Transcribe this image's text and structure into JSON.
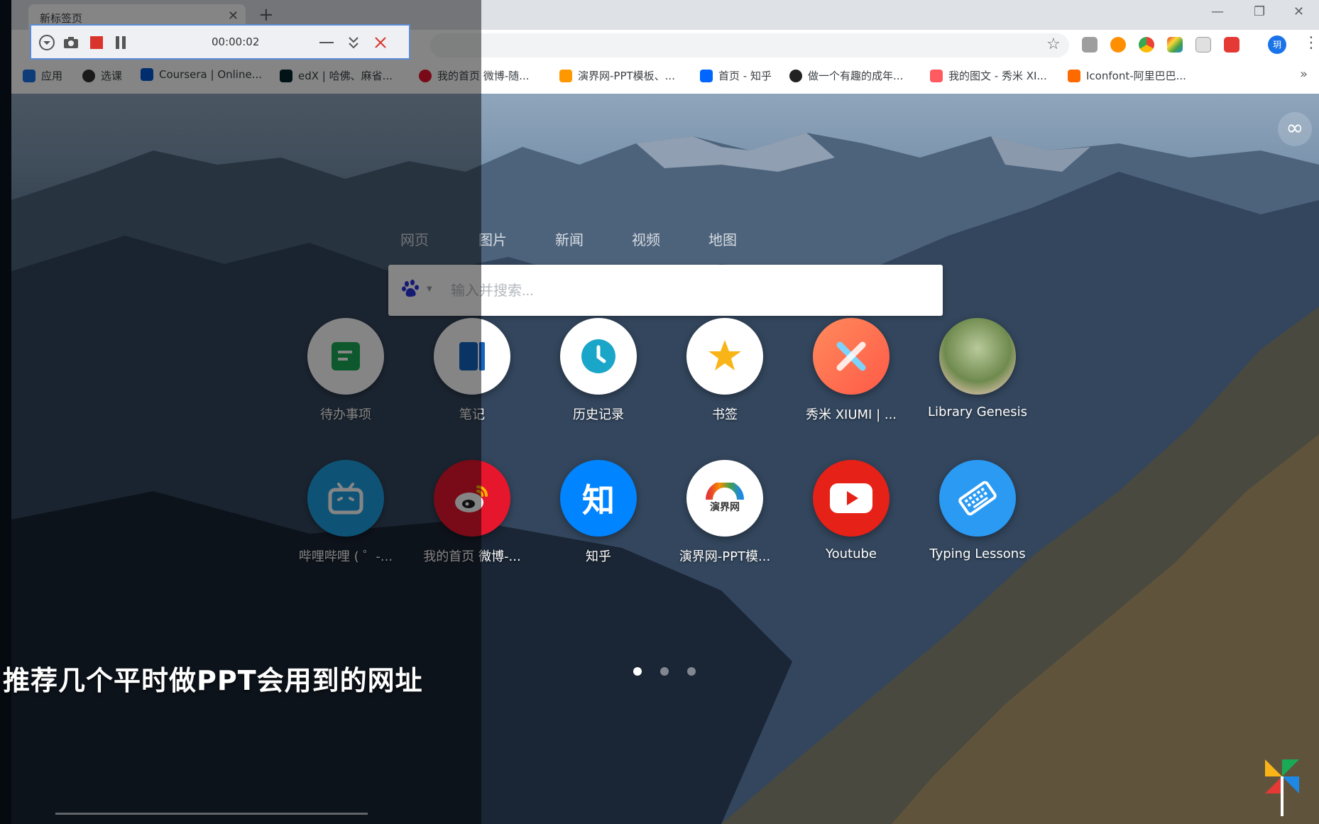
{
  "browser": {
    "tab_title": "新标签页",
    "tab_close": "✕",
    "new_tab": "+",
    "window_controls": {
      "minimize": "—",
      "restore": "❐",
      "close": "✕"
    },
    "toolbar": {
      "star": "☆",
      "profile_initial": "玥",
      "menu": "⋮"
    },
    "extension_icons": [
      "translate-icon",
      "infinity-ext-icon",
      "chrome-ext-icon",
      "color-ext-icon",
      "reader-ext-icon",
      "red-ext-icon"
    ]
  },
  "bookmarks": {
    "items": [
      {
        "label": "应用",
        "icon": "apps-grid-icon",
        "color": "#1a73e8"
      },
      {
        "label": "选课",
        "icon": "globe-icon",
        "color": "#333333"
      },
      {
        "label": "Coursera | Online...",
        "icon": "coursera-icon",
        "color": "#0056d2"
      },
      {
        "label": "edX | 哈佛、麻省...",
        "icon": "edx-icon",
        "color": "#02262b"
      },
      {
        "label": "我的首页 微博-随...",
        "icon": "weibo-icon",
        "color": "#e6162d"
      },
      {
        "label": "演界网-PPT模板、...",
        "icon": "yanjie-icon",
        "color": "#ff9800"
      },
      {
        "label": "首页 - 知乎",
        "icon": "zhihu-icon",
        "color": "#0066ff"
      },
      {
        "label": "做一个有趣的成年...",
        "icon": "dark-site-icon",
        "color": "#222222"
      },
      {
        "label": "我的图文 - 秀米 XI...",
        "icon": "xiumi-icon",
        "color": "#ff5a5f"
      },
      {
        "label": "Iconfont-阿里巴巴...",
        "icon": "iconfont-icon",
        "color": "#ff6a00"
      }
    ],
    "more": "»"
  },
  "newtab": {
    "corner_button": "∞",
    "search_tabs": [
      "网页",
      "图片",
      "新闻",
      "视频",
      "地图"
    ],
    "search_placeholder": "输入并搜索...",
    "engine_icon": "baidu-paw-icon",
    "tiles": [
      {
        "label": "待办事项",
        "icon": "todo-icon",
        "bg": "#ffffff"
      },
      {
        "label": "笔记",
        "icon": "notes-icon",
        "bg": "#ffffff"
      },
      {
        "label": "历史记录",
        "icon": "history-clock-icon",
        "bg": "#ffffff"
      },
      {
        "label": "书签",
        "icon": "bookmark-star-icon",
        "bg": "#ffffff"
      },
      {
        "label": "秀米 XIUMI | ...",
        "icon": "xiumi-tile-icon",
        "bg": "#ff6a47"
      },
      {
        "label": "Library Genesis",
        "icon": "library-genesis-icon",
        "bg": "#8b9a6e"
      },
      {
        "label": "哔哩哔哩 ( ゜-...",
        "icon": "bilibili-icon",
        "bg": "#1ca0e3"
      },
      {
        "label": "我的首页 微博-...",
        "icon": "weibo-tile-icon",
        "bg": "#e6162d"
      },
      {
        "label": "知乎",
        "icon": "zhihu-tile-icon",
        "bg": "#0084ff",
        "glyph": "知"
      },
      {
        "label": "演界网-PPT模...",
        "icon": "yanjie-tile-icon",
        "bg": "#ffffff",
        "glyph": "演界网"
      },
      {
        "label": "Youtube",
        "icon": "youtube-icon",
        "bg": "#e62117"
      },
      {
        "label": "Typing Lessons",
        "icon": "keyboard-icon",
        "bg": "#2b9af3"
      }
    ],
    "page_dots": {
      "count": 3,
      "active": 1
    }
  },
  "recorder": {
    "time": "00:00:02",
    "controls": [
      "dropdown-icon",
      "camera-icon",
      "stop-icon",
      "pause-icon",
      "minimize-icon",
      "collapse-icon",
      "close-icon"
    ]
  },
  "overlay": {
    "subtitle": "推荐几个平时做PPT会用到的网址"
  }
}
